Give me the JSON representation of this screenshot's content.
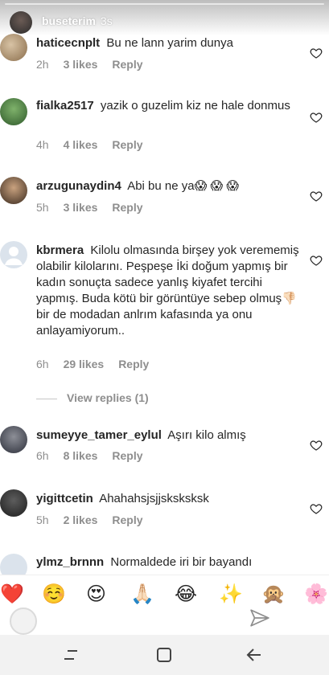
{
  "story": {
    "username": "buseterim",
    "time": "3s"
  },
  "comments": [
    {
      "username": "haticecnplt",
      "text": "Bu ne lann yarim dunya",
      "time": "2h",
      "likes": "3 likes",
      "reply": "Reply"
    },
    {
      "username": "fialka2517",
      "text": "yazik o guzelim kiz ne hale donmus",
      "time": "4h",
      "likes": "4 likes",
      "reply": "Reply"
    },
    {
      "username": "arzugunaydin4",
      "text": "Abi bu ne ya😱 😱 😱",
      "time": "5h",
      "likes": "3 likes",
      "reply": "Reply"
    },
    {
      "username": "kbrmera",
      "text": "Kilolu olmasında birşey yok verememiş olabilir kilolarını. Peşpeşe İki doğum yapmış bir kadın sonuçta sadece yanlış kiyafet tercihi yapmış. Buda kötü bir görüntüye sebep olmuş👎🏻 bir de modadan anlrım kafasında ya onu anlayamiyorum..",
      "time": "6h",
      "likes": "29 likes",
      "reply": "Reply"
    },
    {
      "username": "sumeyye_tamer_eylul",
      "text": "Aşırı kilo almış",
      "time": "6h",
      "likes": "8 likes",
      "reply": "Reply"
    },
    {
      "username": "yigittcetin",
      "text": "Ahahahsjsjjsksksksk",
      "time": "5h",
      "likes": "2 likes",
      "reply": "Reply"
    },
    {
      "username": "ylmz_brnnn",
      "text": "Normaldede iri bir bayandı"
    }
  ],
  "view_replies": "View replies (1)",
  "emoji_bar": [
    "❤️",
    "☺️",
    "😍",
    "🙏🏻",
    "😂",
    "✨",
    "🙊",
    "🌸"
  ],
  "colors": {
    "text": "#262626",
    "meta": "#8e8e8e",
    "heart": "#262626",
    "accent": "#ed4956"
  }
}
